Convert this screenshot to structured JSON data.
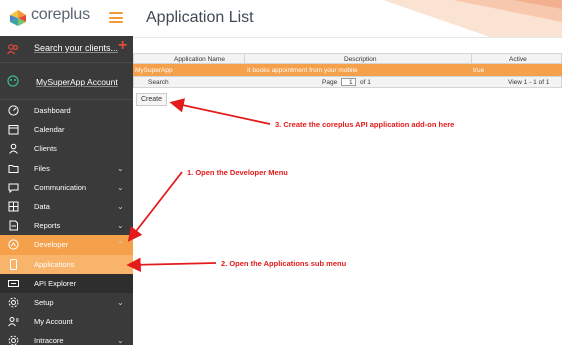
{
  "app": {
    "brand": "coreplus",
    "accent": "#f5a04a",
    "sidebar_bg": "#3a3a3a"
  },
  "sidebar": {
    "search_placeholder": "Search your clients...",
    "account_name": "MySuperApp Account",
    "items": [
      {
        "label": "Dashboard",
        "icon": "dashboard-icon",
        "chevron": ""
      },
      {
        "label": "Calendar",
        "icon": "calendar-icon",
        "chevron": ""
      },
      {
        "label": "Clients",
        "icon": "person-icon",
        "chevron": ""
      },
      {
        "label": "Files",
        "icon": "folder-icon",
        "chevron": "⌄"
      },
      {
        "label": "Communication",
        "icon": "chat-icon",
        "chevron": "⌄"
      },
      {
        "label": "Data",
        "icon": "data-icon",
        "chevron": "⌄"
      },
      {
        "label": "Reports",
        "icon": "report-icon",
        "chevron": "⌄"
      },
      {
        "label": "Developer",
        "icon": "developer-icon",
        "chevron": "⌃"
      },
      {
        "label": "Applications",
        "icon": "phone-icon",
        "chevron": ""
      },
      {
        "label": "API Explorer",
        "icon": "api-icon",
        "chevron": ""
      },
      {
        "label": "Setup",
        "icon": "gear-icon",
        "chevron": "⌄"
      },
      {
        "label": "My Account",
        "icon": "account-icon",
        "chevron": ""
      },
      {
        "label": "Intracore",
        "icon": "intracore-icon",
        "chevron": "⌄"
      }
    ]
  },
  "main": {
    "title": "Application List",
    "grid": {
      "headers": [
        "Application Name",
        "Description",
        "Active"
      ],
      "rows": [
        {
          "name": "MySuperApp",
          "description": "It books appointment from your mobile",
          "active": "true"
        }
      ],
      "footer": {
        "search": "Search",
        "page_label": "Page",
        "page_value": "1",
        "of_label": "of 1",
        "view": "View 1 - 1 of 1"
      }
    },
    "create_label": "Create"
  },
  "annotations": {
    "step1": "1. Open the Developer Menu",
    "step2": "2. Open the Applications sub menu",
    "step3": "3. Create the coreplus API application add-on here",
    "color": "#e31b1b"
  }
}
